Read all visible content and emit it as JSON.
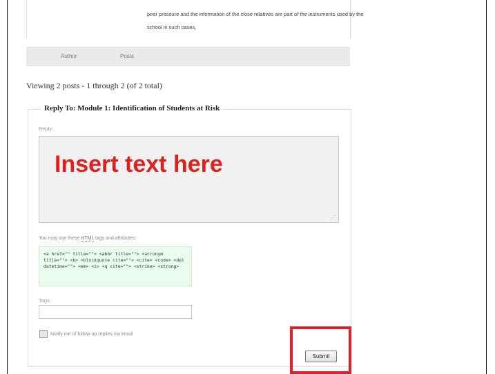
{
  "topic": {
    "post_text": "peer pressure and the information of the close relatives are part of the instruments used by the school in such cases."
  },
  "table_header": {
    "author_label": "Author",
    "posts_label": "Posts"
  },
  "viewing_text": "Viewing 2 posts - 1 through 2 (of 2 total)",
  "reply_form": {
    "legend": "Reply To: Module 1: Identification of Students at Risk",
    "reply_label": "Reply:",
    "textarea_overlay": "Insert text here",
    "allowed_tags_prefix": "You may use these ",
    "allowed_tags_abbr": "HTML",
    "allowed_tags_suffix": " tags and attributes:",
    "allowed_tags_code": "<a href=\"\" title=\"\"> <abbr title=\"\"> <acronym title=\"\"> <b> <blockquote cite=\"\"> <cite> <code> <del datetime=\"\"> <em> <i> <q cite=\"\"> <strike> <strong>",
    "tags_label": "Tags:",
    "tags_value": "",
    "notify_label": "Notify me of follow-up replies via email",
    "notify_checked": false,
    "submit_label": "Submit"
  },
  "colors": {
    "highlight": "#e0202a",
    "overlay_text": "#e1201c",
    "code_background": "#eafcef"
  }
}
